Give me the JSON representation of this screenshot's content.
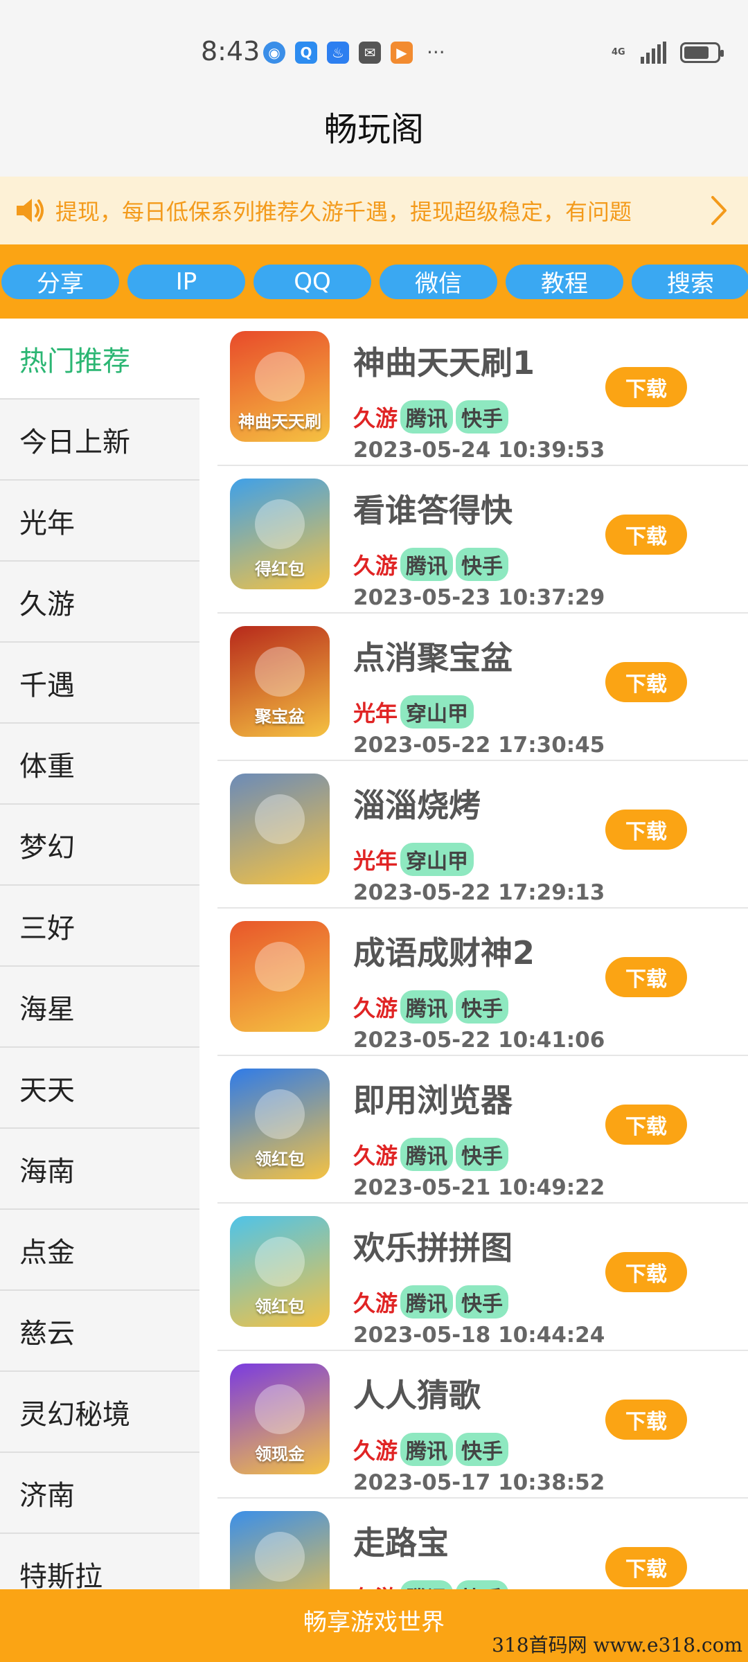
{
  "status_bar": {
    "time": "8:43",
    "more": "···",
    "network": "4G",
    "battery_level": 0.75,
    "icons": [
      "safari-icon",
      "search-app-icon",
      "bulb-app-icon",
      "mail-app-icon",
      "video-app-icon"
    ]
  },
  "header": {
    "title": "畅玩阁"
  },
  "notice": {
    "text": "提现，每日低保系列推荐久游千遇，提现超级稳定，有问题"
  },
  "tabs": [
    {
      "label": "分享"
    },
    {
      "label": "IP"
    },
    {
      "label": "QQ"
    },
    {
      "label": "微信"
    },
    {
      "label": "教程"
    },
    {
      "label": "搜索"
    }
  ],
  "sidebar": {
    "items": [
      {
        "label": "热门推荐",
        "active": true
      },
      {
        "label": "今日上新"
      },
      {
        "label": "光年"
      },
      {
        "label": "久游"
      },
      {
        "label": "千遇"
      },
      {
        "label": "体重"
      },
      {
        "label": "梦幻"
      },
      {
        "label": "三好"
      },
      {
        "label": "海星"
      },
      {
        "label": "天天"
      },
      {
        "label": "海南"
      },
      {
        "label": "点金"
      },
      {
        "label": "慈云"
      },
      {
        "label": "灵幻秘境"
      },
      {
        "label": "济南"
      },
      {
        "label": "特斯拉"
      }
    ]
  },
  "apps": [
    {
      "name": "神曲天天刷1",
      "platform": "久游",
      "tags": [
        "腾讯",
        "快手"
      ],
      "date": "2023-05-24 10:39:53",
      "icon": "fish-game-icon",
      "icon_bg": "#e84a2a",
      "icon_text": "神曲天天刷"
    },
    {
      "name": "看谁答得快",
      "platform": "久游",
      "tags": [
        "腾讯",
        "快手"
      ],
      "date": "2023-05-23 10:37:29",
      "icon": "quiz-game-icon",
      "icon_bg": "#3fa0e8",
      "icon_text": "得红包"
    },
    {
      "name": "点消聚宝盆",
      "platform": "光年",
      "tags": [
        "穿山甲"
      ],
      "date": "2023-05-22 17:30:45",
      "icon": "treasure-bowl-icon",
      "icon_bg": "#b7291b",
      "icon_text": "聚宝盆"
    },
    {
      "name": "淄淄烧烤",
      "platform": "光年",
      "tags": [
        "穿山甲"
      ],
      "date": "2023-05-22 17:29:13",
      "icon": "bbq-chef-icon",
      "icon_bg": "#6b8bb8",
      "icon_text": ""
    },
    {
      "name": "成语成财神2",
      "platform": "久游",
      "tags": [
        "腾讯",
        "快手"
      ],
      "date": "2023-05-22 10:41:06",
      "icon": "wealth-god-icon",
      "icon_bg": "#e8562a",
      "icon_text": ""
    },
    {
      "name": "即用浏览器",
      "platform": "久游",
      "tags": [
        "腾讯",
        "快手"
      ],
      "date": "2023-05-21 10:49:22",
      "icon": "browser-icon",
      "icon_bg": "#2f7be8",
      "icon_text": "领红包"
    },
    {
      "name": "欢乐拼拼图",
      "platform": "久游",
      "tags": [
        "腾讯",
        "快手"
      ],
      "date": "2023-05-18 10:44:24",
      "icon": "puzzle-icon",
      "icon_bg": "#4fc3e8",
      "icon_text": "领红包"
    },
    {
      "name": "人人猜歌",
      "platform": "久游",
      "tags": [
        "腾讯",
        "快手"
      ],
      "date": "2023-05-17 10:38:52",
      "icon": "music-note-icon",
      "icon_bg": "#7a3be0",
      "icon_text": "领现金"
    },
    {
      "name": "走路宝",
      "platform": "久游",
      "tags": [
        "腾讯",
        "快手"
      ],
      "date": "",
      "icon": "sneaker-icon",
      "icon_bg": "#3b8fe8",
      "icon_text": ""
    }
  ],
  "download_label": "下载",
  "footer": {
    "text": "畅享游戏世界"
  },
  "watermark": "318首码网  www.e318.com",
  "colors": {
    "accent_orange": "#fba414",
    "tab_blue": "#3aa8f2",
    "active_green": "#2bb673",
    "tag_red": "#e02424",
    "tag_green_bg": "#8ee8c0"
  }
}
